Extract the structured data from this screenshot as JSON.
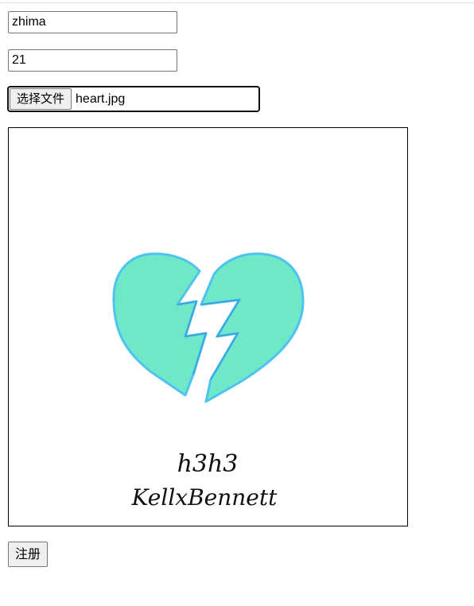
{
  "form": {
    "name_value": "zhima",
    "age_value": "21",
    "file_button_label": "选择文件",
    "file_name": "heart.jpg",
    "submit_label": "注册"
  },
  "preview": {
    "image_description_icon": "broken-heart-icon",
    "signature_line1": "h3h3",
    "signature_line2": "KellxBennett",
    "heart_fill": "#6fe8c8",
    "heart_stroke": "#4fc3f0"
  }
}
